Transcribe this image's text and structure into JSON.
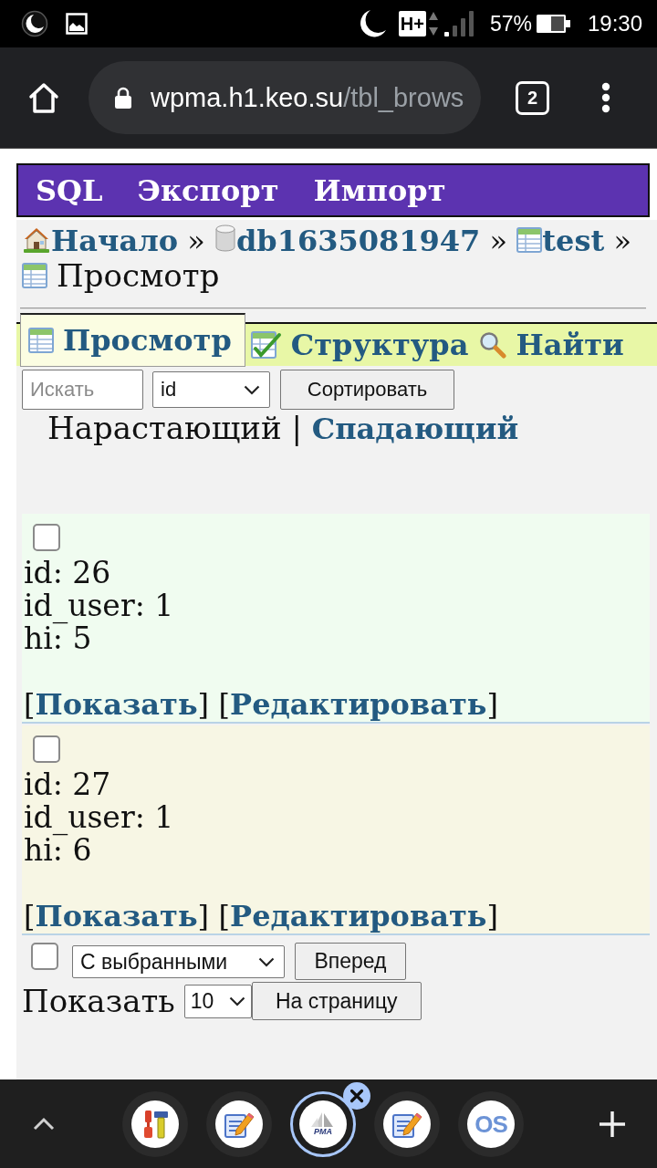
{
  "status_bar": {
    "network_type": "H+",
    "battery": "57%",
    "time": "19:30"
  },
  "browser": {
    "url_host": "wpma.h1.keo.su",
    "url_path": "/tbl_brows",
    "tab_count": "2"
  },
  "top_menu": [
    {
      "label": "SQL"
    },
    {
      "label": "Экспорт"
    },
    {
      "label": "Импорт"
    }
  ],
  "breadcrumb": [
    {
      "kind": "home",
      "label": "Начало",
      "current": false,
      "separator": "»"
    },
    {
      "kind": "database",
      "label": "db1635081947",
      "current": false,
      "separator": "»"
    },
    {
      "kind": "table",
      "label": "test",
      "current": false,
      "separator": "»"
    },
    {
      "kind": "table",
      "label": "Просмотр",
      "current": true
    }
  ],
  "tabs": [
    {
      "kind": "browse",
      "label": "Просмотр",
      "selected": true
    },
    {
      "kind": "structure",
      "label": "Структура",
      "selected": false
    },
    {
      "kind": "search",
      "label": "Найти",
      "selected": false
    }
  ],
  "search_form": {
    "search": {
      "placeholder": "Искать"
    },
    "sort_field": {
      "value": "id"
    },
    "sort_button": "Сортировать"
  },
  "sort_order": {
    "options": [
      {
        "label": "Нарастающий",
        "selected": true
      },
      {
        "label": "Спадающий",
        "selected": false
      }
    ],
    "separator": "|"
  },
  "records": [
    {
      "checked": false,
      "fields": [
        {
          "label": "id:",
          "value": "26"
        },
        {
          "label": "id_user:",
          "value": "1"
        },
        {
          "label": "hi:",
          "value": "5"
        }
      ],
      "actions": [
        {
          "open": "[",
          "label": "Показать",
          "close": "]"
        },
        {
          "open": "[",
          "label": "Редактировать",
          "close": "]"
        }
      ]
    },
    {
      "checked": false,
      "fields": [
        {
          "label": "id:",
          "value": "27"
        },
        {
          "label": "id_user:",
          "value": "1"
        },
        {
          "label": "hi:",
          "value": "6"
        }
      ],
      "actions": [
        {
          "open": "[",
          "label": "Показать",
          "close": "]"
        },
        {
          "open": "[",
          "label": "Редактировать",
          "close": "]"
        }
      ]
    }
  ],
  "bulk_actions": {
    "checked": false,
    "action": {
      "value": "С выбранными"
    },
    "button": "Вперед"
  },
  "paging": {
    "label": "Показать",
    "per_page": {
      "value": "10"
    },
    "button": "На страницу"
  },
  "tab_strip": [
    {
      "kind": "tools",
      "selected": false
    },
    {
      "kind": "notepad",
      "selected": false
    },
    {
      "kind": "sailboat",
      "label": "PMA",
      "selected": true
    },
    {
      "kind": "notepad",
      "selected": false
    },
    {
      "kind": "letters",
      "label": "OS",
      "selected": false
    }
  ]
}
